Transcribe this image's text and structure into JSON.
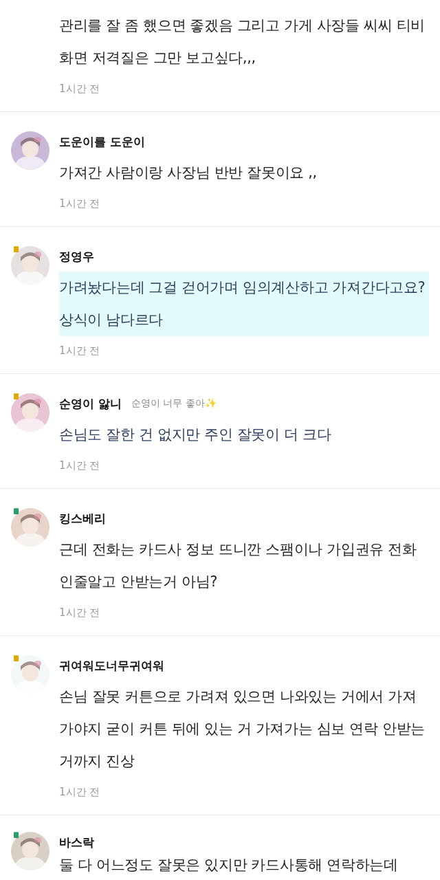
{
  "comments": [
    {
      "kind": "plain",
      "body": "관리를 잘 좀 했으면 좋겠음 그리고 가게 사장들 씨씨 티비 화면 저격질은 그만 보고싶다,,,",
      "time": "1시간 전"
    },
    {
      "kind": "plain",
      "name": "도운이를 도운이",
      "body": "가져간 사람이랑 사장님 반반 잘못이요 ,,",
      "time": "1시간 전"
    },
    {
      "kind": "highlight",
      "name": "정영우",
      "body": "가려놨다는데 그걸 걷어가며 임의계산하고 가져간다고요? 상식이 남다르다",
      "time": "1시간 전",
      "badge": {
        "color": "#e0a800"
      }
    },
    {
      "kind": "blue",
      "name": "순영이 앓니",
      "subtitle": "순영이 너무 좋아✨",
      "body": "손님도 잘한 건 없지만 주인 잘못이 더 크다",
      "time": "1시간 전",
      "badge": {
        "color": "#e0a800"
      }
    },
    {
      "kind": "plain",
      "name": "킹스베리",
      "body": "근데 전화는 카드사 정보 뜨니깐 스팸이나 가입권유 전화 인줄알고 안받는거 아님?",
      "time": "1시간 전",
      "badge": {
        "color": "#2a9d6a"
      }
    },
    {
      "kind": "plain",
      "name": "귀여워도너무귀여워",
      "body": "손님 잘못 커튼으로 가려져 있으면 나와있는 거에서 가져가야지 굳이 커튼 뒤에 있는 거 가져가는 심보 연락 안받는 거까지 진상",
      "time": "1시간 전",
      "badge": {
        "color": "#e0a800"
      }
    },
    {
      "kind": "plain",
      "name": "바스락",
      "body": "둘 다 어느정도 잘못은 있지만 카드사통해 연락하는데",
      "badge": {
        "color": "#2a9d6a"
      }
    }
  ]
}
